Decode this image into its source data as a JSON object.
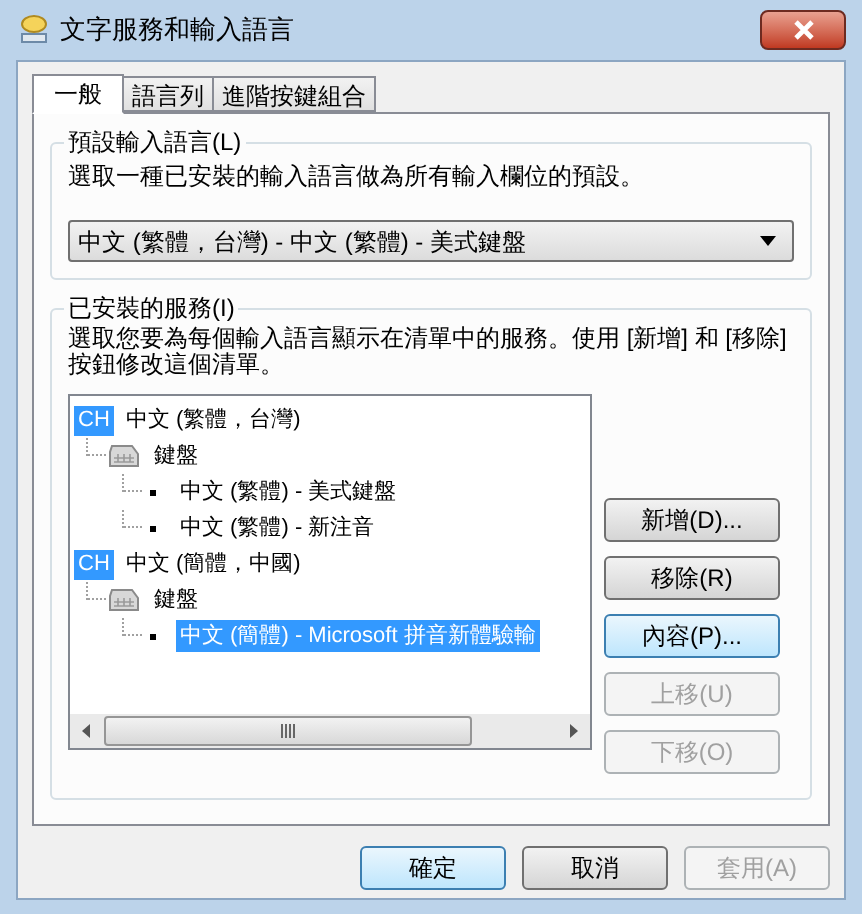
{
  "window": {
    "title": "文字服務和輸入語言"
  },
  "tabs": [
    {
      "label": "一般",
      "selected": true
    },
    {
      "label": "語言列",
      "selected": false
    },
    {
      "label": "進階按鍵組合",
      "selected": false
    }
  ],
  "default_language": {
    "label": "預設輸入語言(L)",
    "description": "選取一種已安裝的輸入語言做為所有輸入欄位的預設。",
    "dropdown": {
      "value": "中文 (繁體，台灣) - 中文 (繁體) - 美式鍵盤"
    }
  },
  "installed_services": {
    "label": "已安裝的服務(I)",
    "description": "選取您要為每個輸入語言顯示在清單中的服務。使用 [新增] 和 [移除] 按鈕修改這個清單。",
    "tree": [
      {
        "kind": "language",
        "badge": "CH",
        "label": "中文 (繁體，台灣)",
        "selected": false,
        "children": [
          {
            "kind": "category",
            "label": "鍵盤",
            "selected": false,
            "children": [
              {
                "kind": "service",
                "label": "中文 (繁體) - 美式鍵盤",
                "selected": false
              },
              {
                "kind": "service",
                "label": "中文 (繁體) - 新注音",
                "selected": false
              }
            ]
          }
        ]
      },
      {
        "kind": "language",
        "badge": "CH",
        "label": "中文 (簡體，中國)",
        "selected": false,
        "children": [
          {
            "kind": "category",
            "label": "鍵盤",
            "selected": false,
            "children": [
              {
                "kind": "service",
                "label": "中文 (簡體) - Microsoft 拼音新體驗輸",
                "selected": true
              }
            ]
          }
        ]
      }
    ],
    "buttons": [
      {
        "label": "新增(D)...",
        "disabled": false,
        "highlighted": false
      },
      {
        "label": "移除(R)",
        "disabled": false,
        "highlighted": false
      },
      {
        "label": "內容(P)...",
        "disabled": false,
        "highlighted": true
      },
      {
        "label": "上移(U)",
        "disabled": true
      },
      {
        "label": "下移(O)",
        "disabled": true
      }
    ]
  },
  "footer_buttons": [
    {
      "label": "確定",
      "disabled": false,
      "highlighted": true
    },
    {
      "label": "取消",
      "disabled": false,
      "highlighted": false
    },
    {
      "label": "套用(A)",
      "disabled": true
    }
  ]
}
